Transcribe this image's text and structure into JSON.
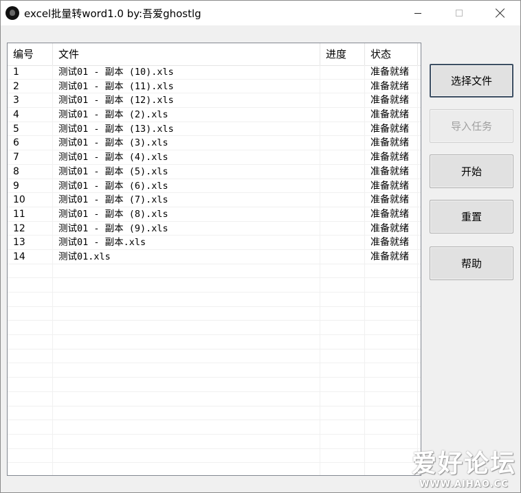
{
  "window": {
    "title": "excel批量转word1.0  by:吾爱ghostlg",
    "app_icon": "app-logo-icon"
  },
  "list": {
    "columns": [
      "编号",
      "文件",
      "进度",
      "状态"
    ],
    "rows": [
      {
        "id": "1",
        "file": "测试01 - 副本 (10).xls",
        "progress": "",
        "status": "准备就绪"
      },
      {
        "id": "2",
        "file": "测试01 - 副本 (11).xls",
        "progress": "",
        "status": "准备就绪"
      },
      {
        "id": "3",
        "file": "测试01 - 副本 (12).xls",
        "progress": "",
        "status": "准备就绪"
      },
      {
        "id": "4",
        "file": "测试01 - 副本 (2).xls",
        "progress": "",
        "status": "准备就绪"
      },
      {
        "id": "5",
        "file": "测试01 - 副本 (13).xls",
        "progress": "",
        "status": "准备就绪"
      },
      {
        "id": "6",
        "file": "测试01 - 副本 (3).xls",
        "progress": "",
        "status": "准备就绪"
      },
      {
        "id": "7",
        "file": "测试01 - 副本 (4).xls",
        "progress": "",
        "status": "准备就绪"
      },
      {
        "id": "8",
        "file": "测试01 - 副本 (5).xls",
        "progress": "",
        "status": "准备就绪"
      },
      {
        "id": "9",
        "file": "测试01 - 副本 (6).xls",
        "progress": "",
        "status": "准备就绪"
      },
      {
        "id": "10",
        "file": "测试01 - 副本 (7).xls",
        "progress": "",
        "status": "准备就绪"
      },
      {
        "id": "11",
        "file": "测试01 - 副本 (8).xls",
        "progress": "",
        "status": "准备就绪"
      },
      {
        "id": "12",
        "file": "测试01 - 副本 (9).xls",
        "progress": "",
        "status": "准备就绪"
      },
      {
        "id": "13",
        "file": "测试01 - 副本.xls",
        "progress": "",
        "status": "准备就绪"
      },
      {
        "id": "14",
        "file": "测试01.xls",
        "progress": "",
        "status": "准备就绪"
      }
    ]
  },
  "buttons": {
    "select_file": "选择文件",
    "import_task": "导入任务",
    "start": "开始",
    "reset": "重置",
    "help": "帮助"
  },
  "watermark": {
    "main": "爱好论坛",
    "sub": "WWW.AIHAO.CC"
  }
}
